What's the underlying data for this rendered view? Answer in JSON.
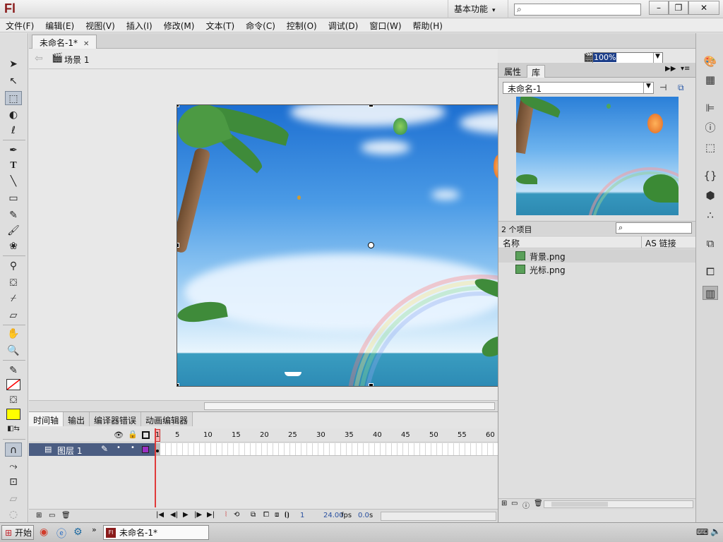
{
  "app": {
    "logo": "Fl",
    "workspace": "基本功能",
    "search_placeholder": ""
  },
  "window_buttons": [
    "–",
    "❐",
    "✕"
  ],
  "menu": [
    "文件(F)",
    "编辑(E)",
    "视图(V)",
    "插入(I)",
    "修改(M)",
    "文本(T)",
    "命令(C)",
    "控制(O)",
    "调试(D)",
    "窗口(W)",
    "帮助(H)"
  ],
  "document": {
    "tab_title": "未命名-1*",
    "scene": "场景 1",
    "zoom": "100%"
  },
  "timeline": {
    "tabs": [
      "时间轴",
      "输出",
      "编译器错误",
      "动画编辑器"
    ],
    "frame_numbers": [
      "1",
      "5",
      "10",
      "15",
      "20",
      "25",
      "30",
      "35",
      "40",
      "45",
      "50",
      "55",
      "60"
    ],
    "layer_name": "图层 1",
    "footer": {
      "current_frame": "1",
      "fps": "24.00",
      "fps_unit": "fps",
      "time": "0.0",
      "time_unit": "s"
    }
  },
  "right_panel": {
    "tabs": [
      "属性",
      "库"
    ],
    "library_name": "未命名-1",
    "item_count": "2 个项目",
    "col_name": "名称",
    "col_link": "AS 链接",
    "items": [
      {
        "name": "背景.png",
        "icon": "bitmap-icon"
      },
      {
        "name": "光标.png",
        "icon": "bitmap-icon"
      }
    ]
  },
  "taskbar": {
    "start": "开始",
    "task": "未命名-1*"
  },
  "colors": {
    "stroke": "#ff0000",
    "fill": "#ffff00",
    "layer_selected": "#4b5d82",
    "playhead": "#e03a3a"
  }
}
